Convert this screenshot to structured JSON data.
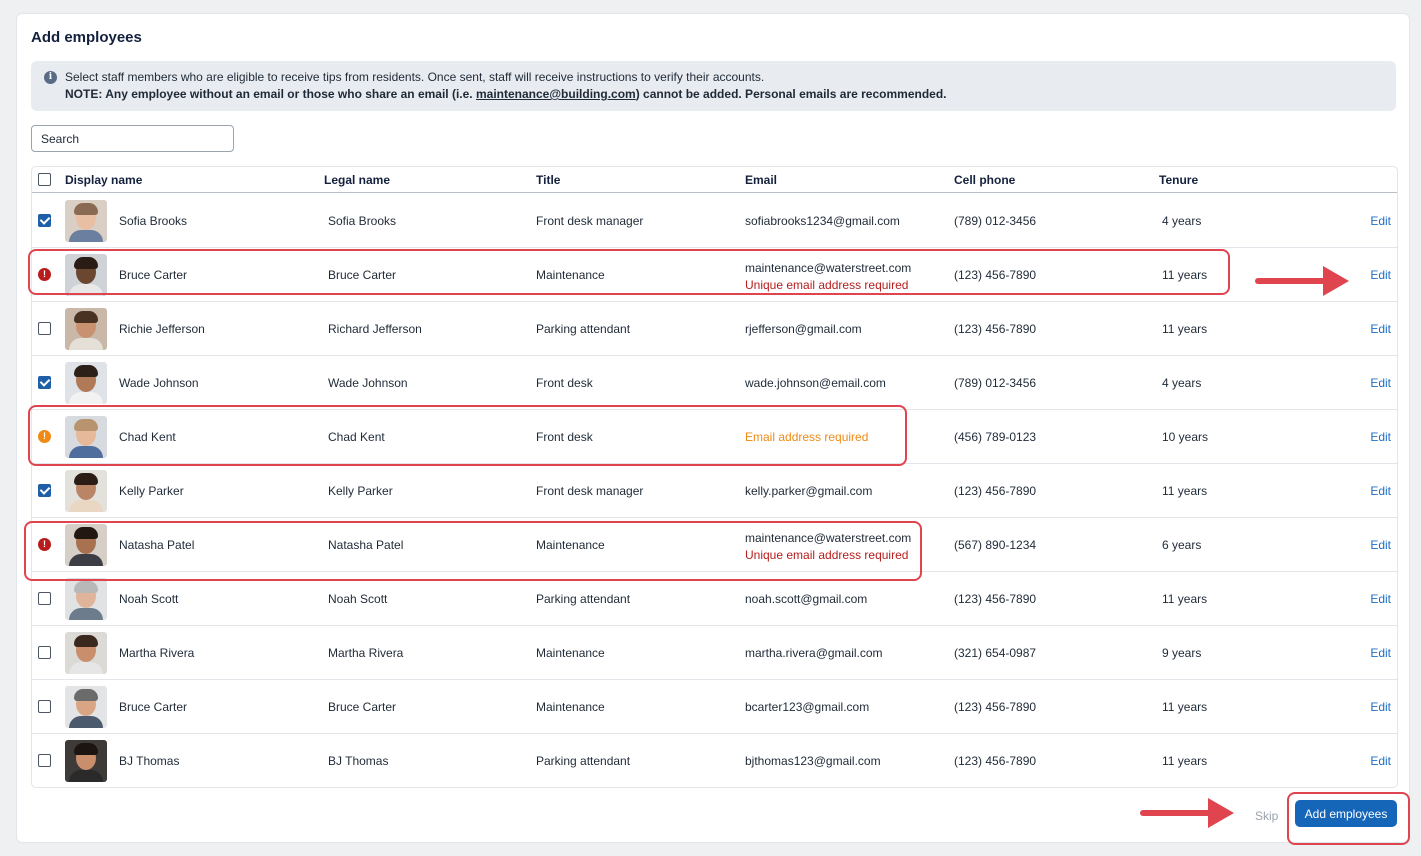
{
  "page": {
    "title": "Add employees",
    "info_text": "Select staff members who are eligible to receive tips from residents. Once sent, staff will receive instructions to verify their accounts.",
    "note_prefix": "NOTE: Any employee without an email or those who share an email (i.e. ",
    "note_email": "maintenance@building.com",
    "note_suffix": ") cannot be added. Personal emails are recommended."
  },
  "search": {
    "placeholder": "Search"
  },
  "columns": {
    "display_name": "Display name",
    "legal_name": "Legal name",
    "title": "Title",
    "email": "Email",
    "cell_phone": "Cell phone",
    "tenure": "Tenure"
  },
  "edit_label": "Edit",
  "rows": [
    {
      "state": "checked",
      "display": "Sofia Brooks",
      "legal": "Sofia Brooks",
      "title": "Front desk manager",
      "email": "sofiabrooks1234@gmail.com",
      "error": "",
      "phone": "(789) 012-3456",
      "tenure": "4 years"
    },
    {
      "state": "error",
      "display": "Bruce Carter",
      "legal": "Bruce Carter",
      "title": "Maintenance",
      "email": "maintenance@waterstreet.com",
      "error": "Unique email address required",
      "phone": "(123) 456-7890",
      "tenure": "11 years"
    },
    {
      "state": "unchecked",
      "display": "Richie Jefferson",
      "legal": "Richard Jefferson",
      "title": "Parking attendant",
      "email": "rjefferson@gmail.com",
      "error": "",
      "phone": "(123) 456-7890",
      "tenure": "11 years"
    },
    {
      "state": "checked",
      "display": "Wade Johnson",
      "legal": "Wade Johnson",
      "title": "Front desk",
      "email": "wade.johnson@email.com",
      "error": "",
      "phone": "(789) 012-3456",
      "tenure": "4 years"
    },
    {
      "state": "warning",
      "display": "Chad Kent",
      "legal": "Chad Kent",
      "title": "Front desk",
      "email": "",
      "error": "Email address required",
      "phone": "(456) 789-0123",
      "tenure": "10 years"
    },
    {
      "state": "checked",
      "display": "Kelly Parker",
      "legal": "Kelly Parker",
      "title": "Front desk manager",
      "email": "kelly.parker@gmail.com",
      "error": "",
      "phone": "(123) 456-7890",
      "tenure": "11 years"
    },
    {
      "state": "error",
      "display": "Natasha Patel",
      "legal": "Natasha Patel",
      "title": "Maintenance",
      "email": "maintenance@waterstreet.com",
      "error": "Unique email address required",
      "phone": "(567) 890-1234",
      "tenure": "6 years"
    },
    {
      "state": "unchecked",
      "display": "Noah Scott",
      "legal": "Noah Scott",
      "title": "Parking attendant",
      "email": "noah.scott@gmail.com",
      "error": "",
      "phone": "(123) 456-7890",
      "tenure": "11 years"
    },
    {
      "state": "unchecked",
      "display": "Martha Rivera",
      "legal": "Martha Rivera",
      "title": "Maintenance",
      "email": "martha.rivera@gmail.com",
      "error": "",
      "phone": "(321) 654-0987",
      "tenure": "9 years"
    },
    {
      "state": "unchecked",
      "display": "Bruce Carter",
      "legal": "Bruce Carter",
      "title": "Maintenance",
      "email": "bcarter123@gmail.com",
      "error": "",
      "phone": "(123) 456-7890",
      "tenure": "11 years"
    },
    {
      "state": "unchecked",
      "display": "BJ Thomas",
      "legal": "BJ Thomas",
      "title": "Parking attendant",
      "email": "bjthomas123@gmail.com",
      "error": "",
      "phone": "(123) 456-7890",
      "tenure": "11 years"
    }
  ],
  "footer": {
    "skip_label": "Skip",
    "add_label": "Add employees"
  },
  "colors": {
    "accent": "#1565b8",
    "error": "#b81d1d",
    "warning": "#ef8a14",
    "annotation": "#e0444f"
  }
}
